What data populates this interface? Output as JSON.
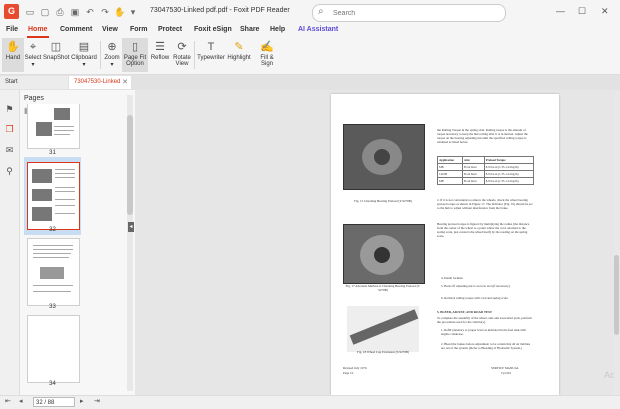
{
  "app": {
    "title": "73047530-Linked pdf.pdf - Foxit PDF Reader",
    "logo_letter": "G",
    "search_placeholder": "Search",
    "window_controls": [
      "—",
      "☐",
      "✕"
    ]
  },
  "menu": {
    "items": [
      "File",
      "Home",
      "Comment",
      "View",
      "Form",
      "Protect",
      "Foxit eSign",
      "Share",
      "Help",
      "AI Assistant"
    ],
    "active": "Home"
  },
  "ribbon": {
    "buttons": [
      {
        "label": "Hand",
        "icon": "hand-icon"
      },
      {
        "label": "Select",
        "icon": "cursor-icon",
        "dropdown": true
      },
      {
        "label": "SnapShot",
        "icon": "camera-icon"
      },
      {
        "label": "Clipboard",
        "icon": "clipboard-icon",
        "dropdown": true
      },
      {
        "label": "Zoom",
        "icon": "zoom-icon",
        "dropdown": true
      },
      {
        "label": "Page Fit Option",
        "icon": "page-fit-icon",
        "dropdown": true
      },
      {
        "label": "Reflow",
        "icon": "reflow-icon"
      },
      {
        "label": "Rotate View",
        "icon": "rotate-icon",
        "dropdown": true
      },
      {
        "label": "Typewriter",
        "icon": "typewriter-icon"
      },
      {
        "label": "Highlight",
        "icon": "highlight-icon"
      },
      {
        "label": "Fill & Sign",
        "icon": "fill-sign-icon"
      }
    ]
  },
  "tabs": [
    {
      "label": "Start"
    },
    {
      "label": "73047530-Linked pdf...",
      "active": true
    }
  ],
  "pages_panel": {
    "title": "Pages",
    "thumbnails": [
      {
        "label": "31"
      },
      {
        "label": "32",
        "selected": true
      },
      {
        "label": "33"
      },
      {
        "label": "34"
      }
    ]
  },
  "document": {
    "right_col_intro": "the Rolling Torque in the spring strut. Rolling torque is the amount of torque necessary to keep the hub rolling after it is in motion. Adjust the torque on the bearing adjusting nut until the specified rolling torque is obtained as listed below.",
    "table": {
      "headers": [
        "Application",
        "Axle",
        "Preload Torque"
      ],
      "rows": [
        [
          "MB",
          "Front Rear",
          "8-9 lbs-in (1.35-1.24 kg/m)"
        ],
        [
          "1401B",
          "Front Rear",
          "8-9 lbs-in (1.35-1.24 kg/m)"
        ],
        [
          "MB",
          "Front Rear",
          "8-9 lbs-in (1.35-1.24 kg/m)"
        ]
      ]
    },
    "fig15": "Fig. 15 Checking Bearing Preload (T-9279B)",
    "fig17": "Fig. 17 Alternate Method of Checking Bearing Preload (T-9279B)",
    "fig18": "Fig. 18 Wheel Cup Extension (T-9279B)",
    "para2": "2. If it is not convenient to remove the wheels, check the wheel bearing preload torque as shown in Figure 17. The indicator (Fig. 16) should be set to the hub to adjust without interference from the brake.",
    "para3": "Bearing preload torque is figured by multiplying the radius (the distance from the center of the wheel to a point where the cord, attached to the spring scale, just contacts the wheel itself) by the reading on the spring scale.",
    "steps": [
      "4. Install locknut.",
      "5. Back off adjusting nut to recover slot (if necessary).",
      "6. Recheck rolling torque with cord and spring scale."
    ],
    "section": "5. BLEED, ADJUST, AND ROAD TEST",
    "section_body": "To complete the assembly of the wheel, axle and associated parts, perform the procedures used for the vehicle(s).",
    "steps2": [
      "1. Refill planetary to proper level as indicated in the fuel tank with engine crankcase.",
      "2. Bleed the brakes before adjustment to be certain that all air bubbles are out of the system. (Refer to Bleeding of Hydraulic System.)"
    ],
    "footer_left": "Revised July 1976",
    "footer_center": "Page 10",
    "footer_right1": "SERVICE MANUAL",
    "footer_right2": "Cpt 601"
  },
  "status": {
    "page_value": "32 / 88"
  },
  "watermark": "Ac"
}
